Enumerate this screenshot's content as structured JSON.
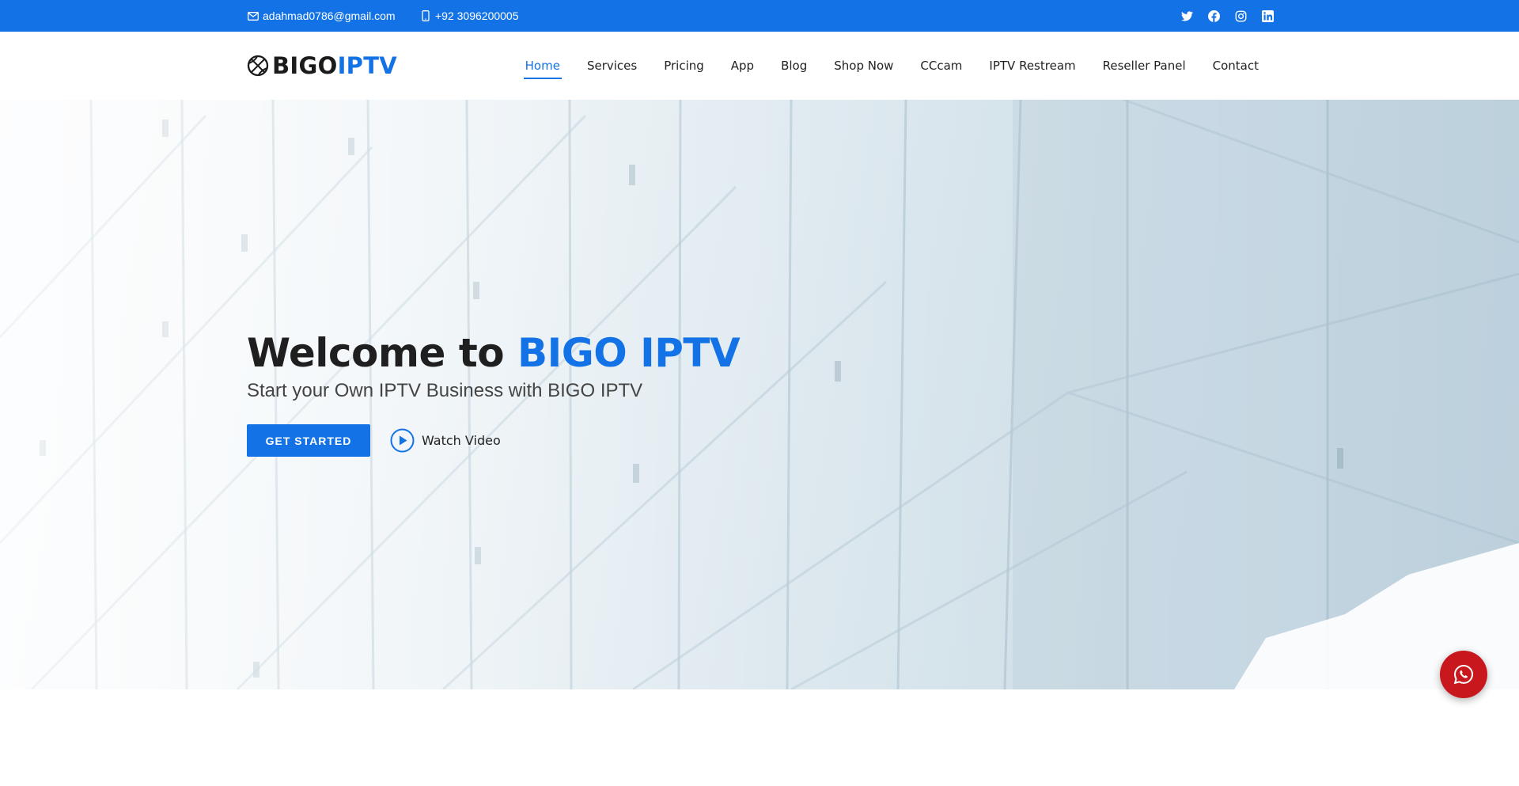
{
  "topbar": {
    "email": "adahmad0786@gmail.com",
    "phone": "+92 3096200005",
    "email_icon": "envelope-icon",
    "phone_icon": "phone-icon",
    "socials": [
      "twitter-icon",
      "facebook-icon",
      "instagram-icon",
      "linkedin-icon"
    ],
    "background_color": "#1372e6"
  },
  "header": {
    "logo_part1": "BIGO",
    "logo_part2": "IPTV",
    "logo_icon": "basketball-icon",
    "nav": [
      {
        "label": "Home",
        "active": true
      },
      {
        "label": "Services"
      },
      {
        "label": "Pricing"
      },
      {
        "label": "App"
      },
      {
        "label": "Blog"
      },
      {
        "label": "Shop Now"
      },
      {
        "label": "CCcam"
      },
      {
        "label": "IPTV Restream"
      },
      {
        "label": "Reseller Panel"
      },
      {
        "label": "Contact"
      }
    ]
  },
  "hero": {
    "title_prefix": "Welcome to ",
    "title_accent": "BIGO IPTV",
    "subtitle": "Start your Own IPTV Business with BIGO IPTV",
    "cta_label": "GET STARTED",
    "watch_label": "Watch Video",
    "watch_icon": "play-circle-icon",
    "accent_color": "#1372e6"
  },
  "floating": {
    "whatsapp_icon": "whatsapp-icon",
    "color": "#c8181e"
  }
}
